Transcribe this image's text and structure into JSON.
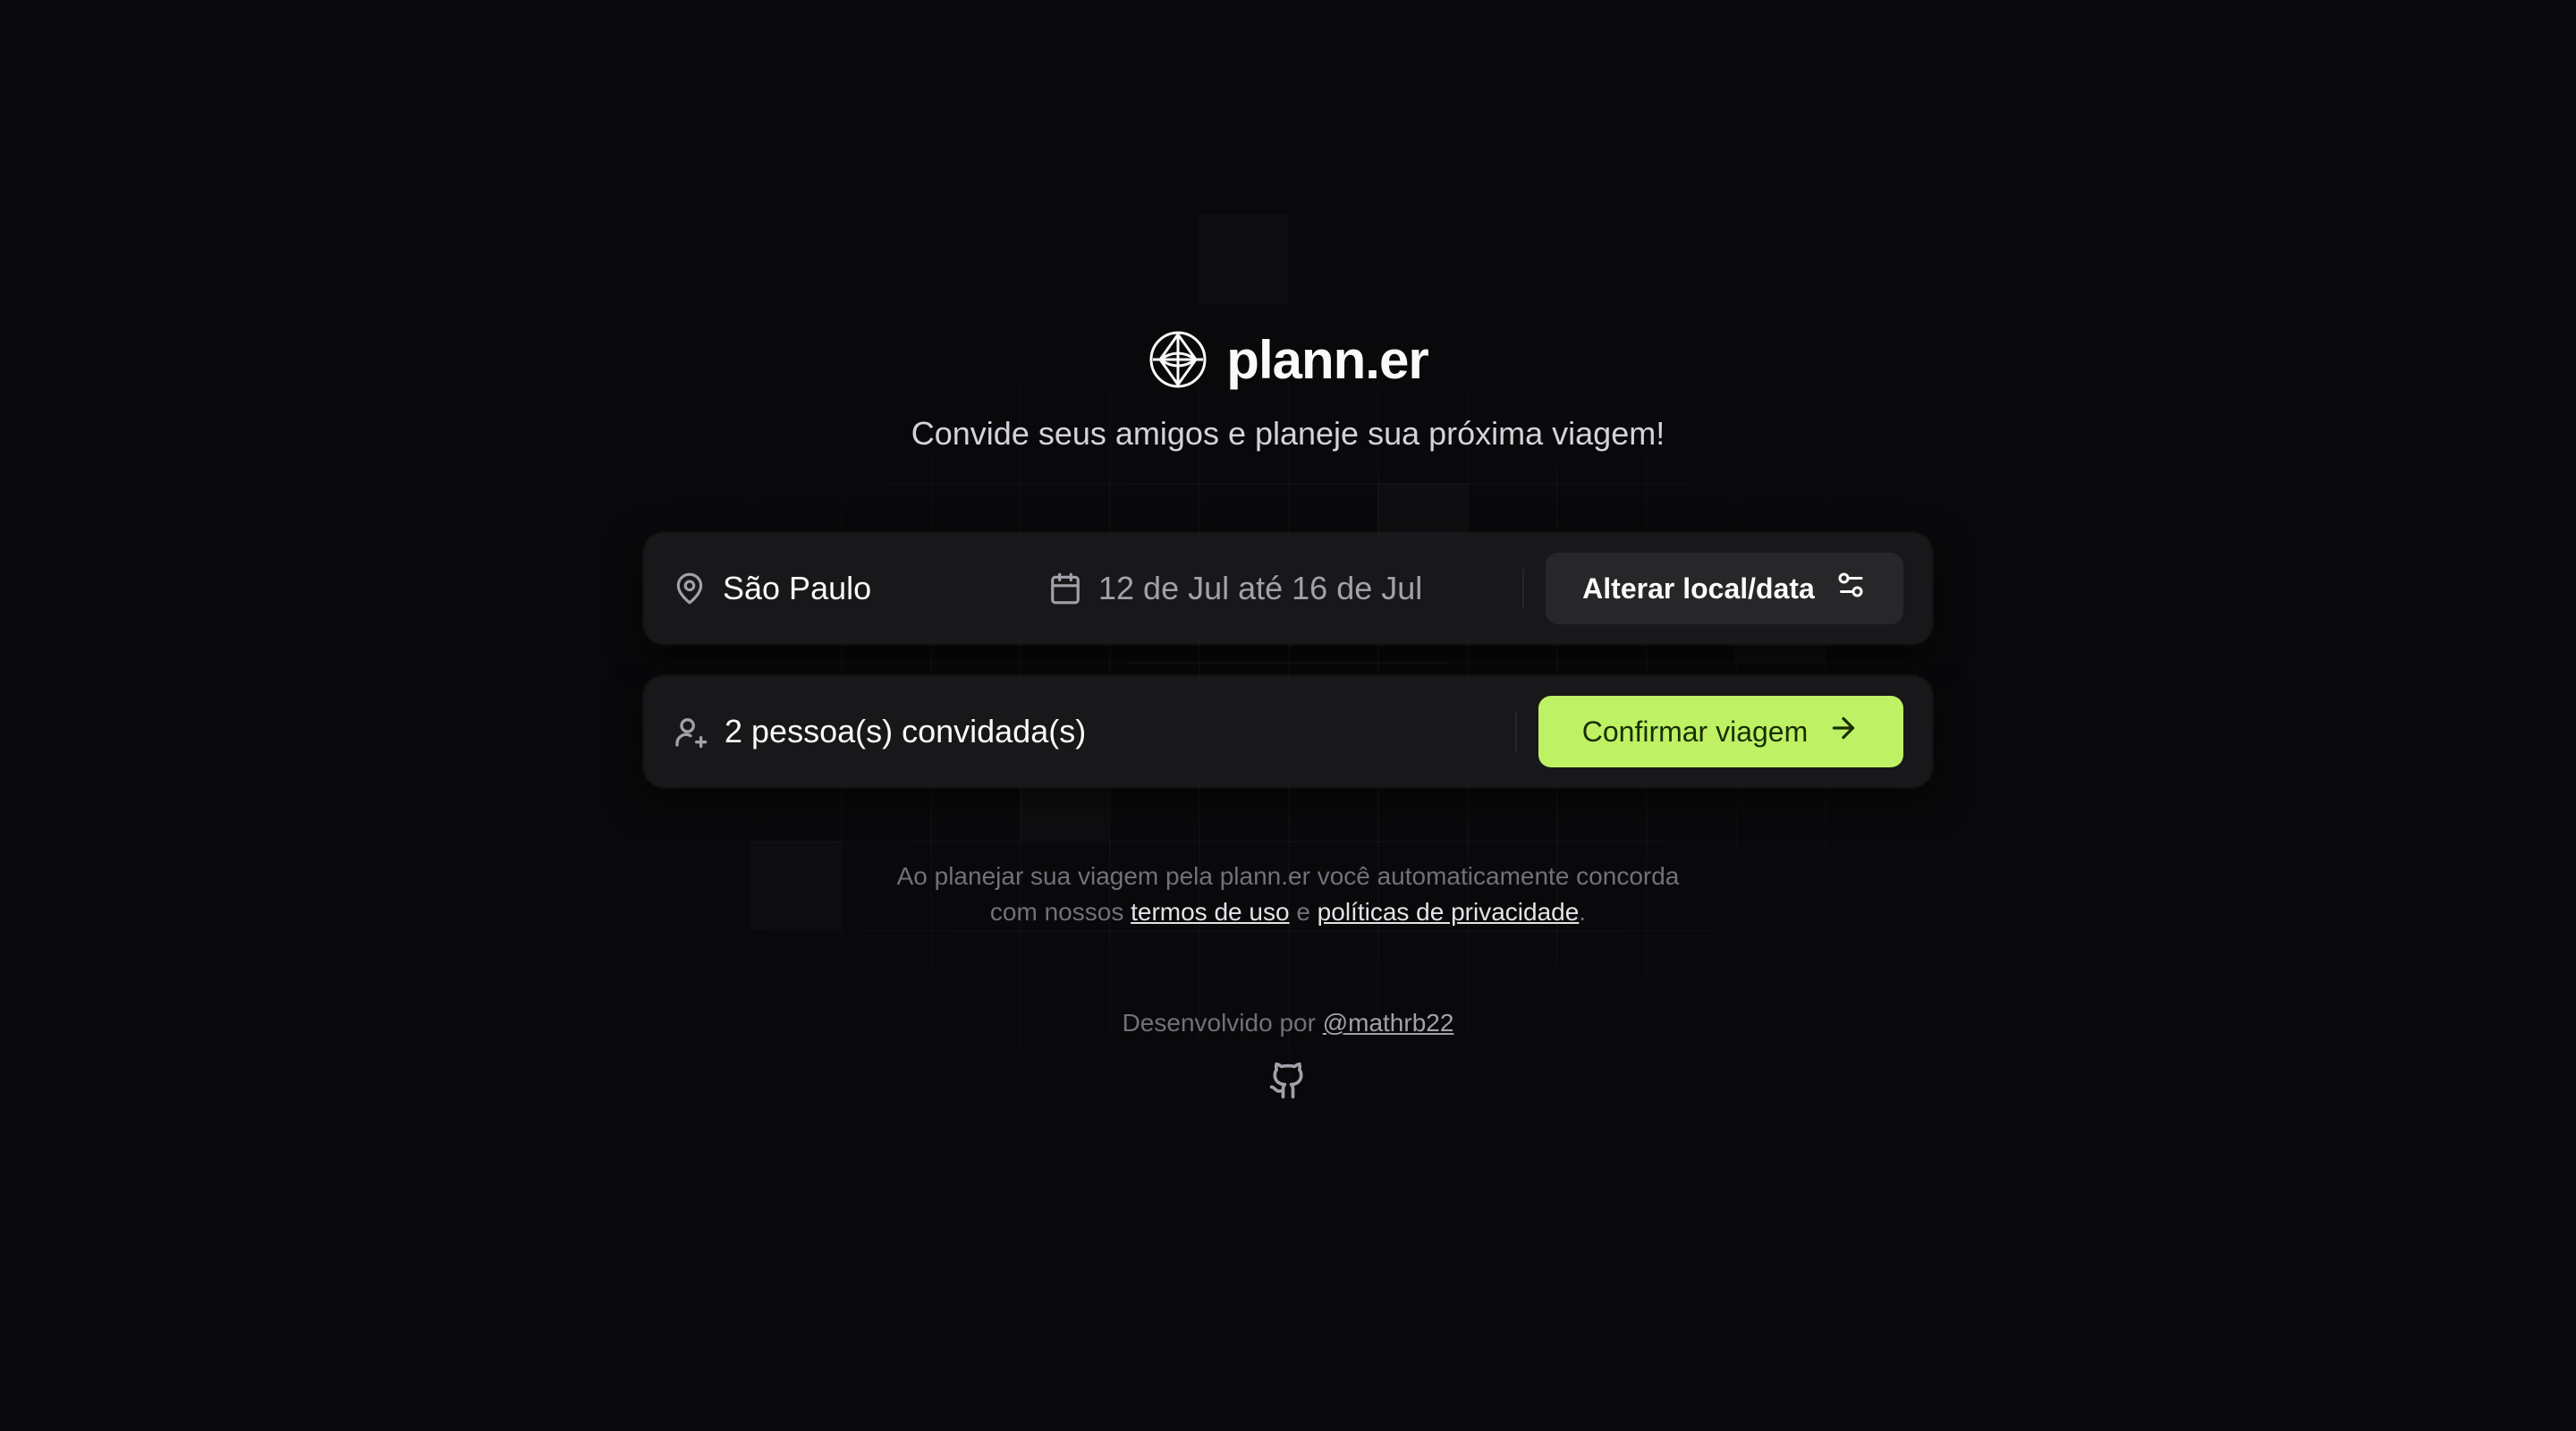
{
  "brand": {
    "name": "plann.er",
    "logo_icon": "globe-icon"
  },
  "subtitle": "Convide seus amigos e planeje sua próxima viagem!",
  "destination": {
    "icon": "map-pin-icon",
    "value": "São Paulo"
  },
  "dates": {
    "icon": "calendar-icon",
    "value": "12 de Jul até 16 de Jul"
  },
  "change_button": {
    "label": "Alterar local/data",
    "icon": "settings-sliders-icon"
  },
  "guests": {
    "icon": "user-plus-icon",
    "value": "2 pessoa(s) convidada(s)"
  },
  "confirm_button": {
    "label": "Confirmar viagem",
    "icon": "arrow-right-icon"
  },
  "terms": {
    "line1": "Ao planejar sua viagem pela plann.er você automaticamente concorda",
    "line2_prefix": "com nossos",
    "terms_link": "termos de uso",
    "conjunction": "e",
    "privacy_link": "políticas de privacidade",
    "suffix": "."
  },
  "footer": {
    "prefix": "Desenvolvido por",
    "author_link": "@mathrb22",
    "github_icon": "github-icon"
  },
  "colors": {
    "background": "#09090b",
    "card": "#18181b",
    "accent": "#bef264",
    "secondary_button": "#27272a"
  }
}
